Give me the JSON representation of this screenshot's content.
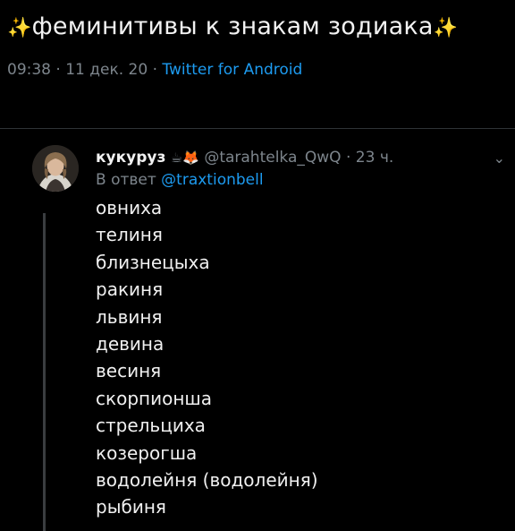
{
  "tweet": {
    "sparkle_left": "✨",
    "title": "феминитивы к знакам зодиака",
    "sparkle_right": "✨",
    "time": "09:38",
    "date": "11 дек. 20",
    "separator": "·",
    "source": "Twitter for Android"
  },
  "reply": {
    "display_name": "кукуруз",
    "emoji": "☕🦊",
    "handle": "@tarahtelka_QwQ",
    "separator": "·",
    "age": "23 ч.",
    "menu_icon": "chevron-down-icon",
    "reply_to_label": "В ответ",
    "reply_to_handle": "@traxtionbell",
    "lines": [
      "овниха",
      "телиня",
      "близнецыха",
      "ракиня",
      "львиня",
      "девина",
      "весиня",
      "скорпионша",
      "стрельциха",
      "козерогша",
      "водолейня (водолейня)",
      "рыбиня"
    ]
  },
  "colors": {
    "background": "#000000",
    "text": "#f0f0f0",
    "muted": "#7d858c",
    "link": "#1d9bf0",
    "divider": "#2f3336"
  }
}
